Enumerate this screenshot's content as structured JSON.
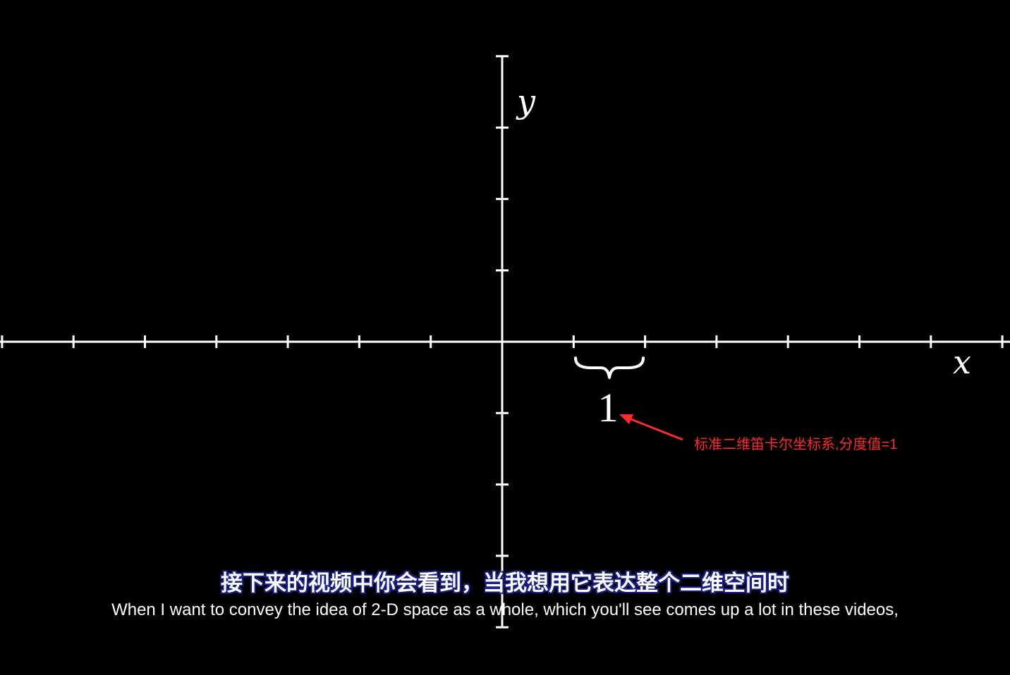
{
  "diagram": {
    "x_axis_label": "x",
    "y_axis_label": "y",
    "unit_label": "1",
    "unit_tick_spacing": 1,
    "x_range": [
      -7,
      7
    ],
    "y_range": [
      -4,
      4
    ],
    "axis_color": "#ffffff",
    "background_color": "#000000"
  },
  "annotation": {
    "text": "标准二维笛卡尔坐标系,分度值=1",
    "color": "#ff2a2a"
  },
  "subtitles": {
    "chinese": "接下来的视频中你会看到，当我想用它表达整个二维空间时",
    "english": "When I want to convey the idea of 2-D space as a whole, which you'll see comes up a lot in these videos,"
  }
}
